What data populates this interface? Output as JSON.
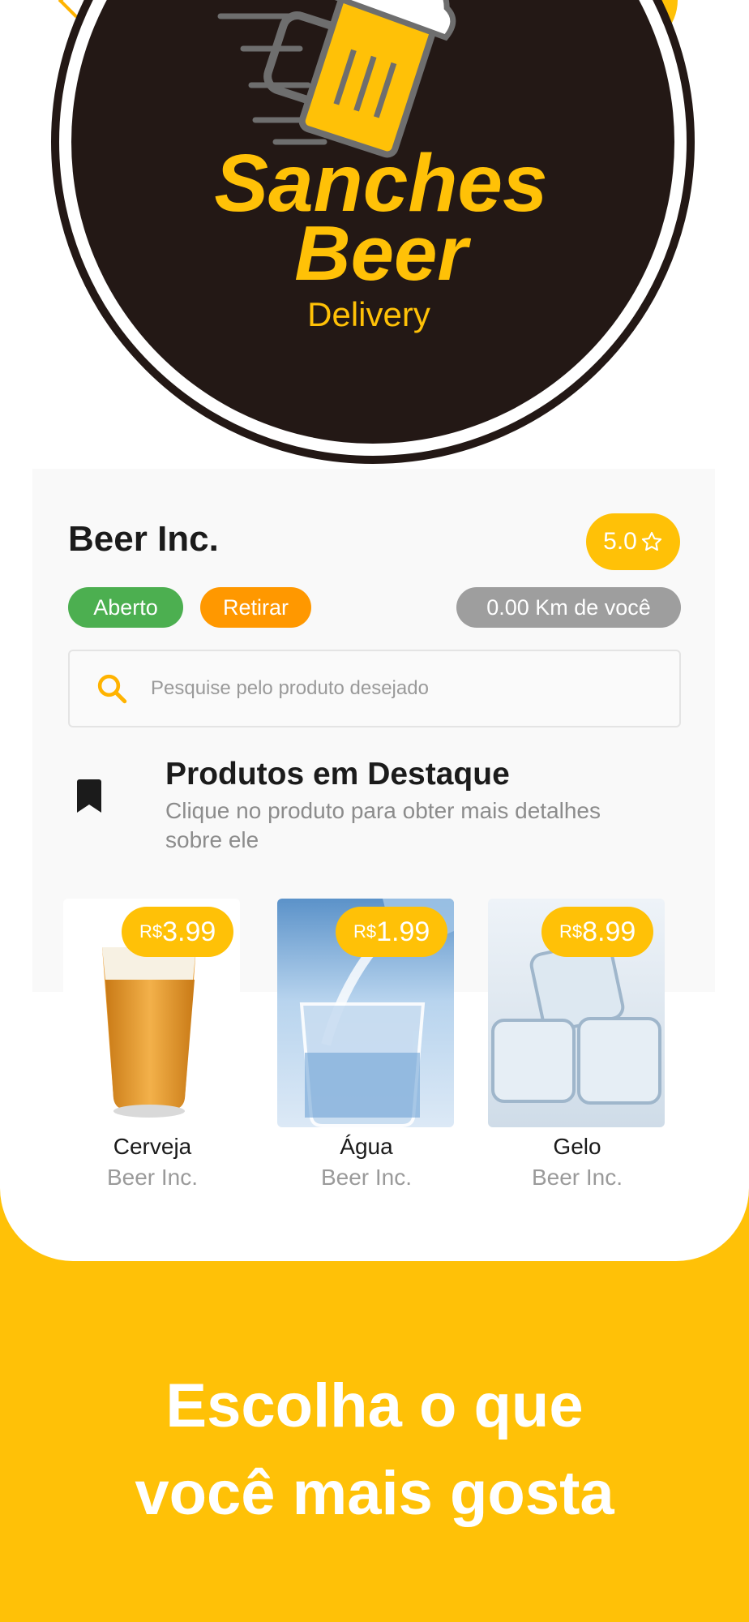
{
  "logo": {
    "line1": "Sanches",
    "line2": "Beer",
    "line3": "Delivery"
  },
  "store": {
    "name": "Beer Inc.",
    "rating": "5.0",
    "status": "Aberto",
    "pickup": "Retirar",
    "distance": "0.00 Km de você"
  },
  "search": {
    "placeholder": "Pesquise pelo produto desejado"
  },
  "featured": {
    "title": "Produtos em Destaque",
    "subtitle": "Clique no produto para obter mais detalhes sobre ele"
  },
  "products": [
    {
      "name": "Cerveja",
      "store": "Beer Inc.",
      "currency": "R$",
      "price": "3.99"
    },
    {
      "name": "Água",
      "store": "Beer Inc.",
      "currency": "R$",
      "price": "1.99"
    },
    {
      "name": "Gelo",
      "store": "Beer Inc.",
      "currency": "R$",
      "price": "8.99"
    }
  ],
  "tagline": {
    "line1": "Escolha o que",
    "line2": "você mais gosta"
  },
  "colors": {
    "brand_yellow": "#FFC107",
    "logo_dark": "#231815",
    "open_green": "#4CAF50",
    "pickup_orange": "#FF9800",
    "distance_gray": "#9E9E9E"
  }
}
